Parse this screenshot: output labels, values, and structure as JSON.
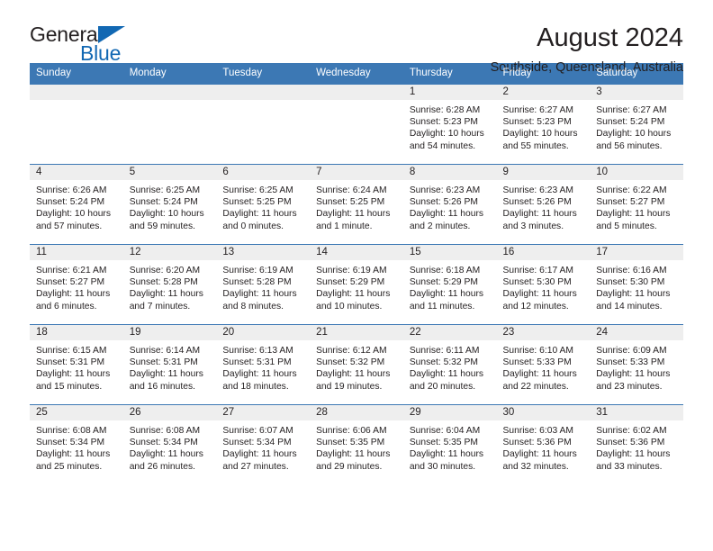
{
  "brand": {
    "name_part1": "General",
    "name_part2": "Blue",
    "accent_color": "#1268b3"
  },
  "header": {
    "title": "August 2024",
    "subtitle": "Southside, Queensland, Australia"
  },
  "theme": {
    "header_row_color": "#3c78b4",
    "daynum_band_color": "#eeeeee",
    "text_color": "#231f20"
  },
  "weekdays": [
    "Sunday",
    "Monday",
    "Tuesday",
    "Wednesday",
    "Thursday",
    "Friday",
    "Saturday"
  ],
  "weeks": [
    [
      {
        "day": "",
        "empty": true
      },
      {
        "day": "",
        "empty": true
      },
      {
        "day": "",
        "empty": true
      },
      {
        "day": "",
        "empty": true
      },
      {
        "day": "1",
        "sunrise": "Sunrise: 6:28 AM",
        "sunset": "Sunset: 5:23 PM",
        "daylight": "Daylight: 10 hours and 54 minutes."
      },
      {
        "day": "2",
        "sunrise": "Sunrise: 6:27 AM",
        "sunset": "Sunset: 5:23 PM",
        "daylight": "Daylight: 10 hours and 55 minutes."
      },
      {
        "day": "3",
        "sunrise": "Sunrise: 6:27 AM",
        "sunset": "Sunset: 5:24 PM",
        "daylight": "Daylight: 10 hours and 56 minutes."
      }
    ],
    [
      {
        "day": "4",
        "sunrise": "Sunrise: 6:26 AM",
        "sunset": "Sunset: 5:24 PM",
        "daylight": "Daylight: 10 hours and 57 minutes."
      },
      {
        "day": "5",
        "sunrise": "Sunrise: 6:25 AM",
        "sunset": "Sunset: 5:24 PM",
        "daylight": "Daylight: 10 hours and 59 minutes."
      },
      {
        "day": "6",
        "sunrise": "Sunrise: 6:25 AM",
        "sunset": "Sunset: 5:25 PM",
        "daylight": "Daylight: 11 hours and 0 minutes."
      },
      {
        "day": "7",
        "sunrise": "Sunrise: 6:24 AM",
        "sunset": "Sunset: 5:25 PM",
        "daylight": "Daylight: 11 hours and 1 minute."
      },
      {
        "day": "8",
        "sunrise": "Sunrise: 6:23 AM",
        "sunset": "Sunset: 5:26 PM",
        "daylight": "Daylight: 11 hours and 2 minutes."
      },
      {
        "day": "9",
        "sunrise": "Sunrise: 6:23 AM",
        "sunset": "Sunset: 5:26 PM",
        "daylight": "Daylight: 11 hours and 3 minutes."
      },
      {
        "day": "10",
        "sunrise": "Sunrise: 6:22 AM",
        "sunset": "Sunset: 5:27 PM",
        "daylight": "Daylight: 11 hours and 5 minutes."
      }
    ],
    [
      {
        "day": "11",
        "sunrise": "Sunrise: 6:21 AM",
        "sunset": "Sunset: 5:27 PM",
        "daylight": "Daylight: 11 hours and 6 minutes."
      },
      {
        "day": "12",
        "sunrise": "Sunrise: 6:20 AM",
        "sunset": "Sunset: 5:28 PM",
        "daylight": "Daylight: 11 hours and 7 minutes."
      },
      {
        "day": "13",
        "sunrise": "Sunrise: 6:19 AM",
        "sunset": "Sunset: 5:28 PM",
        "daylight": "Daylight: 11 hours and 8 minutes."
      },
      {
        "day": "14",
        "sunrise": "Sunrise: 6:19 AM",
        "sunset": "Sunset: 5:29 PM",
        "daylight": "Daylight: 11 hours and 10 minutes."
      },
      {
        "day": "15",
        "sunrise": "Sunrise: 6:18 AM",
        "sunset": "Sunset: 5:29 PM",
        "daylight": "Daylight: 11 hours and 11 minutes."
      },
      {
        "day": "16",
        "sunrise": "Sunrise: 6:17 AM",
        "sunset": "Sunset: 5:30 PM",
        "daylight": "Daylight: 11 hours and 12 minutes."
      },
      {
        "day": "17",
        "sunrise": "Sunrise: 6:16 AM",
        "sunset": "Sunset: 5:30 PM",
        "daylight": "Daylight: 11 hours and 14 minutes."
      }
    ],
    [
      {
        "day": "18",
        "sunrise": "Sunrise: 6:15 AM",
        "sunset": "Sunset: 5:31 PM",
        "daylight": "Daylight: 11 hours and 15 minutes."
      },
      {
        "day": "19",
        "sunrise": "Sunrise: 6:14 AM",
        "sunset": "Sunset: 5:31 PM",
        "daylight": "Daylight: 11 hours and 16 minutes."
      },
      {
        "day": "20",
        "sunrise": "Sunrise: 6:13 AM",
        "sunset": "Sunset: 5:31 PM",
        "daylight": "Daylight: 11 hours and 18 minutes."
      },
      {
        "day": "21",
        "sunrise": "Sunrise: 6:12 AM",
        "sunset": "Sunset: 5:32 PM",
        "daylight": "Daylight: 11 hours and 19 minutes."
      },
      {
        "day": "22",
        "sunrise": "Sunrise: 6:11 AM",
        "sunset": "Sunset: 5:32 PM",
        "daylight": "Daylight: 11 hours and 20 minutes."
      },
      {
        "day": "23",
        "sunrise": "Sunrise: 6:10 AM",
        "sunset": "Sunset: 5:33 PM",
        "daylight": "Daylight: 11 hours and 22 minutes."
      },
      {
        "day": "24",
        "sunrise": "Sunrise: 6:09 AM",
        "sunset": "Sunset: 5:33 PM",
        "daylight": "Daylight: 11 hours and 23 minutes."
      }
    ],
    [
      {
        "day": "25",
        "sunrise": "Sunrise: 6:08 AM",
        "sunset": "Sunset: 5:34 PM",
        "daylight": "Daylight: 11 hours and 25 minutes."
      },
      {
        "day": "26",
        "sunrise": "Sunrise: 6:08 AM",
        "sunset": "Sunset: 5:34 PM",
        "daylight": "Daylight: 11 hours and 26 minutes."
      },
      {
        "day": "27",
        "sunrise": "Sunrise: 6:07 AM",
        "sunset": "Sunset: 5:34 PM",
        "daylight": "Daylight: 11 hours and 27 minutes."
      },
      {
        "day": "28",
        "sunrise": "Sunrise: 6:06 AM",
        "sunset": "Sunset: 5:35 PM",
        "daylight": "Daylight: 11 hours and 29 minutes."
      },
      {
        "day": "29",
        "sunrise": "Sunrise: 6:04 AM",
        "sunset": "Sunset: 5:35 PM",
        "daylight": "Daylight: 11 hours and 30 minutes."
      },
      {
        "day": "30",
        "sunrise": "Sunrise: 6:03 AM",
        "sunset": "Sunset: 5:36 PM",
        "daylight": "Daylight: 11 hours and 32 minutes."
      },
      {
        "day": "31",
        "sunrise": "Sunrise: 6:02 AM",
        "sunset": "Sunset: 5:36 PM",
        "daylight": "Daylight: 11 hours and 33 minutes."
      }
    ]
  ]
}
